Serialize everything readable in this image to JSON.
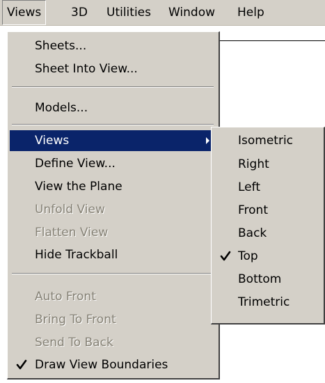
{
  "menubar": {
    "items": [
      "Views",
      "3D",
      "Utilities",
      "Window",
      "Help"
    ]
  },
  "views_menu": {
    "items": [
      {
        "label": "Sheets...",
        "enabled": true
      },
      {
        "label": "Sheet Into View...",
        "enabled": true
      },
      {
        "label": "Models...",
        "enabled": true
      },
      {
        "label": "Views",
        "enabled": true,
        "highlighted": true,
        "has_submenu": true
      },
      {
        "label": "Define View...",
        "enabled": true
      },
      {
        "label": "View the Plane",
        "enabled": true
      },
      {
        "label": "Unfold View",
        "enabled": false
      },
      {
        "label": "Flatten View",
        "enabled": false
      },
      {
        "label": "Hide Trackball",
        "enabled": true
      },
      {
        "label": "Auto Front",
        "enabled": false
      },
      {
        "label": "Bring To Front",
        "enabled": false
      },
      {
        "label": "Send To Back",
        "enabled": false
      },
      {
        "label": "Draw View Boundaries",
        "enabled": true,
        "checked": true
      }
    ]
  },
  "views_submenu": {
    "items": [
      {
        "label": "Isometric"
      },
      {
        "label": "Right"
      },
      {
        "label": "Left"
      },
      {
        "label": "Front"
      },
      {
        "label": "Back"
      },
      {
        "label": "Top",
        "checked": true
      },
      {
        "label": "Bottom"
      },
      {
        "label": "Trimetric"
      }
    ]
  },
  "icons": {
    "check": "checkmark-icon",
    "submenu_arrow": "submenu-arrow-icon"
  },
  "colors": {
    "menu_bg": "#d4d0c8",
    "highlight_bg": "#0a246a",
    "highlight_text": "#ffffff",
    "disabled_text": "#868276"
  }
}
